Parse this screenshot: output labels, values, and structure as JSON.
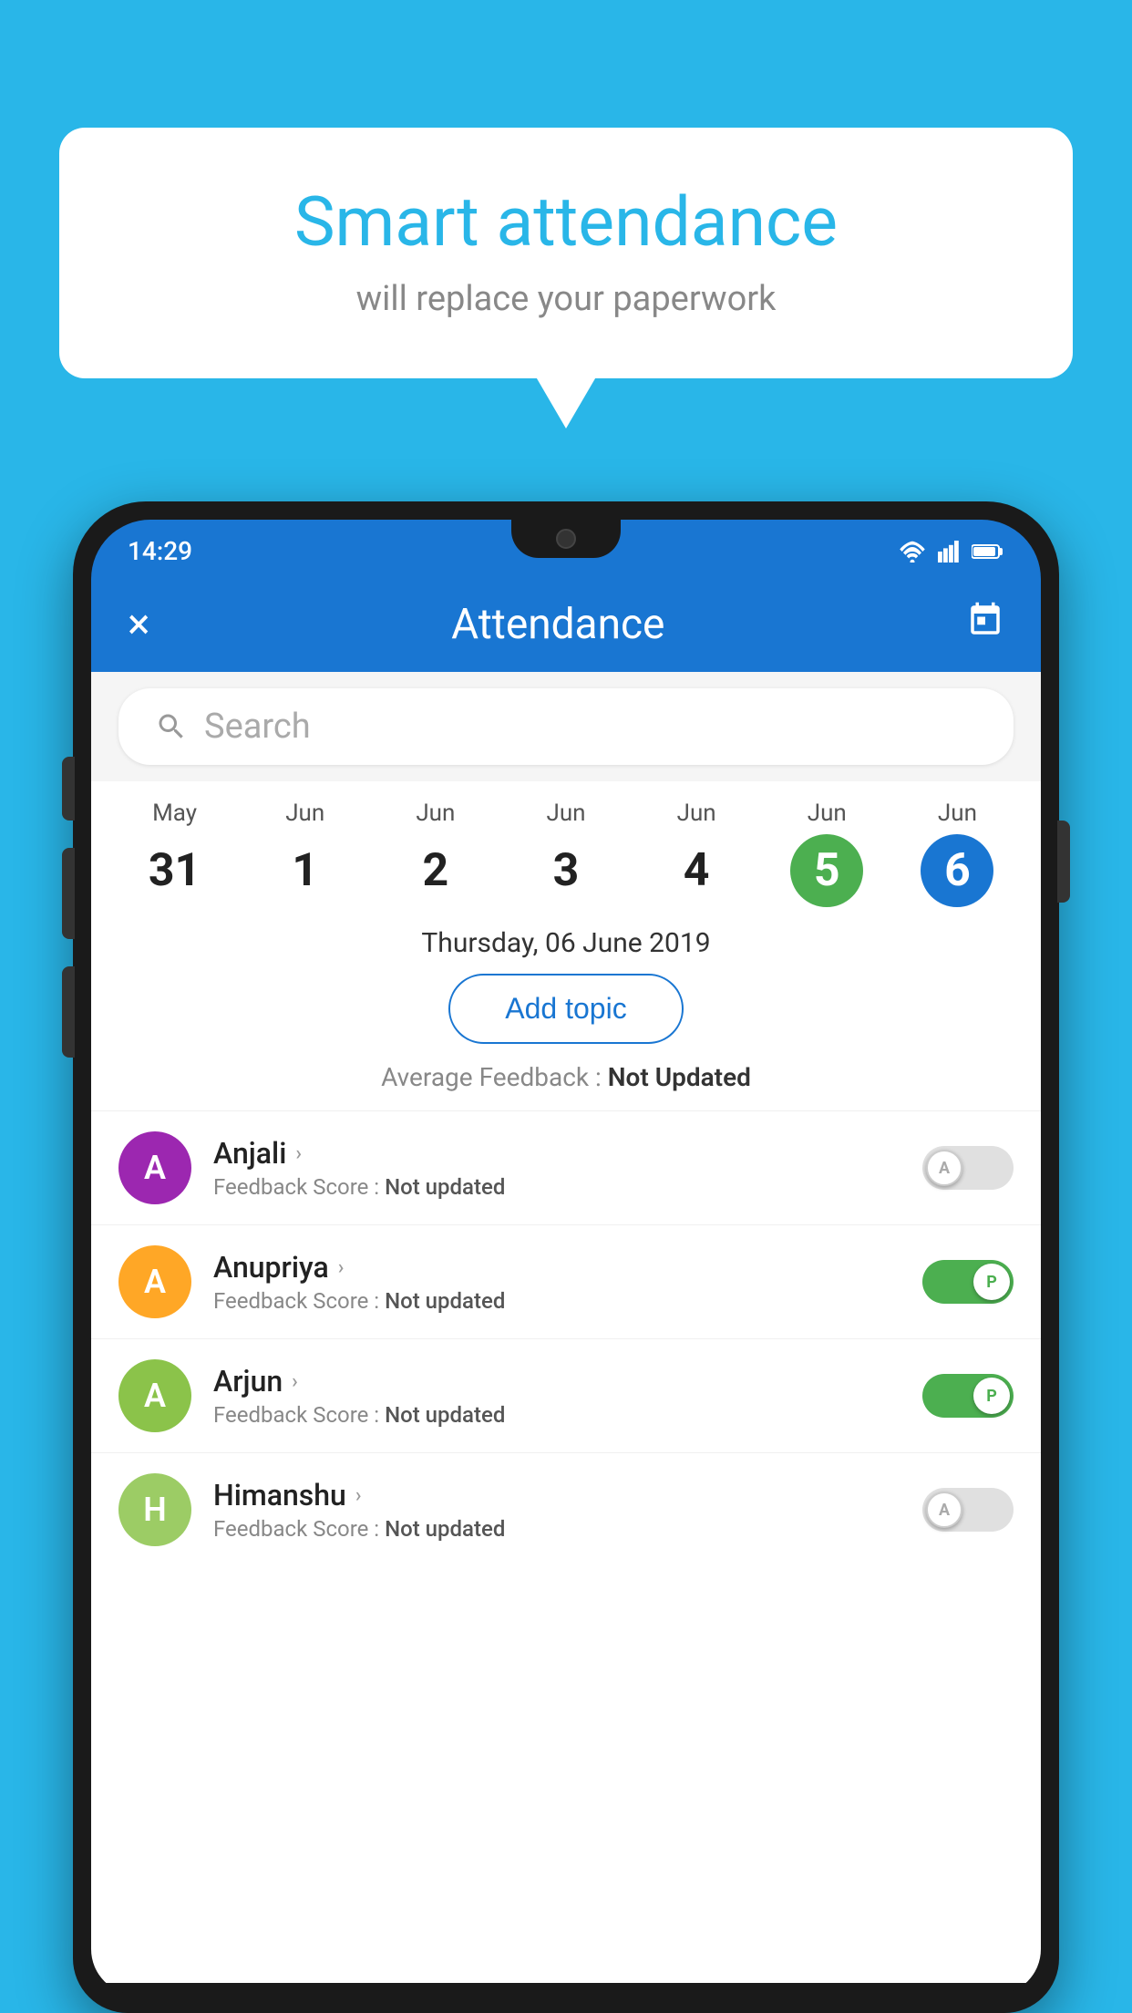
{
  "app": {
    "background_color": "#29b6e8"
  },
  "speech_bubble": {
    "title": "Smart attendance",
    "subtitle": "will replace your paperwork"
  },
  "status_bar": {
    "time": "14:29",
    "icons": [
      "wifi",
      "signal",
      "battery"
    ]
  },
  "app_bar": {
    "title": "Attendance",
    "close_icon": "×",
    "calendar_icon": "📅"
  },
  "search": {
    "placeholder": "Search"
  },
  "date_strip": {
    "dates": [
      {
        "month": "May",
        "day": "31",
        "style": "normal"
      },
      {
        "month": "Jun",
        "day": "1",
        "style": "normal"
      },
      {
        "month": "Jun",
        "day": "2",
        "style": "normal"
      },
      {
        "month": "Jun",
        "day": "3",
        "style": "normal"
      },
      {
        "month": "Jun",
        "day": "4",
        "style": "normal"
      },
      {
        "month": "Jun",
        "day": "5",
        "style": "green"
      },
      {
        "month": "Jun",
        "day": "6",
        "style": "blue"
      }
    ]
  },
  "selected_date": {
    "label": "Thursday, 06 June 2019"
  },
  "add_topic": {
    "label": "Add topic"
  },
  "avg_feedback": {
    "label": "Average Feedback : ",
    "value": "Not Updated"
  },
  "students": [
    {
      "name": "Anjali",
      "avatar_letter": "A",
      "avatar_color": "#9c27b0",
      "feedback_label": "Feedback Score : ",
      "feedback_value": "Not updated",
      "toggle": "off",
      "toggle_letter": "A"
    },
    {
      "name": "Anupriya",
      "avatar_letter": "A",
      "avatar_color": "#ffa726",
      "feedback_label": "Feedback Score : ",
      "feedback_value": "Not updated",
      "toggle": "on",
      "toggle_letter": "P"
    },
    {
      "name": "Arjun",
      "avatar_letter": "A",
      "avatar_color": "#8bc34a",
      "feedback_label": "Feedback Score : ",
      "feedback_value": "Not updated",
      "toggle": "on",
      "toggle_letter": "P"
    },
    {
      "name": "Himanshu",
      "avatar_letter": "H",
      "avatar_color": "#9ccc65",
      "feedback_label": "Feedback Score : ",
      "feedback_value": "Not updated",
      "toggle": "off",
      "toggle_letter": "A"
    }
  ]
}
